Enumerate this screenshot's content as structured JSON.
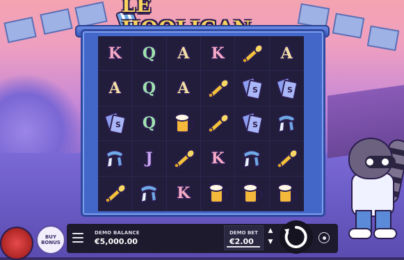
{
  "game": {
    "logo_text": "LE HOOLIGAN"
  },
  "grid": {
    "rows": [
      [
        "K",
        "Q",
        "A",
        "K",
        "horn",
        "A"
      ],
      [
        "A",
        "Q",
        "A",
        "horn",
        "tickets",
        "tickets"
      ],
      [
        "tickets",
        "Q",
        "beer",
        "horn",
        "tickets",
        "scarf"
      ],
      [
        "scarf",
        "J",
        "horn",
        "K",
        "scarf",
        "horn"
      ],
      [
        "horn",
        "scarf",
        "K",
        "beer",
        "beer",
        "beer"
      ]
    ]
  },
  "controls": {
    "buy_bonus_label": "BUY BONUS",
    "balance_label": "DEMO BALANCE",
    "balance_value": "€5,000.00",
    "bet_label": "DEMO BET",
    "bet_value": "€2.00"
  },
  "icons": {
    "menu": "hamburger-menu-icon",
    "spin": "spin-arrow-icon",
    "autoplay": "autoplay-icon",
    "bet_up": "chevron-up-icon",
    "bet_down": "chevron-down-icon"
  },
  "colors": {
    "frame": "#4367c9",
    "grid_bg": "#211d3b",
    "control_bar": "#1c1a2c",
    "logo": "#fbd460"
  }
}
